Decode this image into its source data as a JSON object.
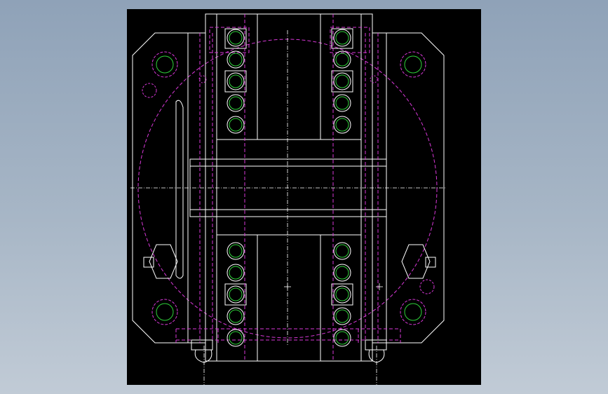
{
  "app": {
    "view_background": "#000000",
    "desktop_gradient": [
      "#8fa2b8",
      "#c1cbd6"
    ]
  },
  "drawing": {
    "colors": {
      "outline": "#ffffff",
      "hidden": "#d838d8",
      "bolt": "#2fd13a",
      "center": "#ffffff"
    },
    "bolt_rows": 5,
    "bolt_columns": 2,
    "bolt_groups": 2,
    "corner_holes": 4
  }
}
